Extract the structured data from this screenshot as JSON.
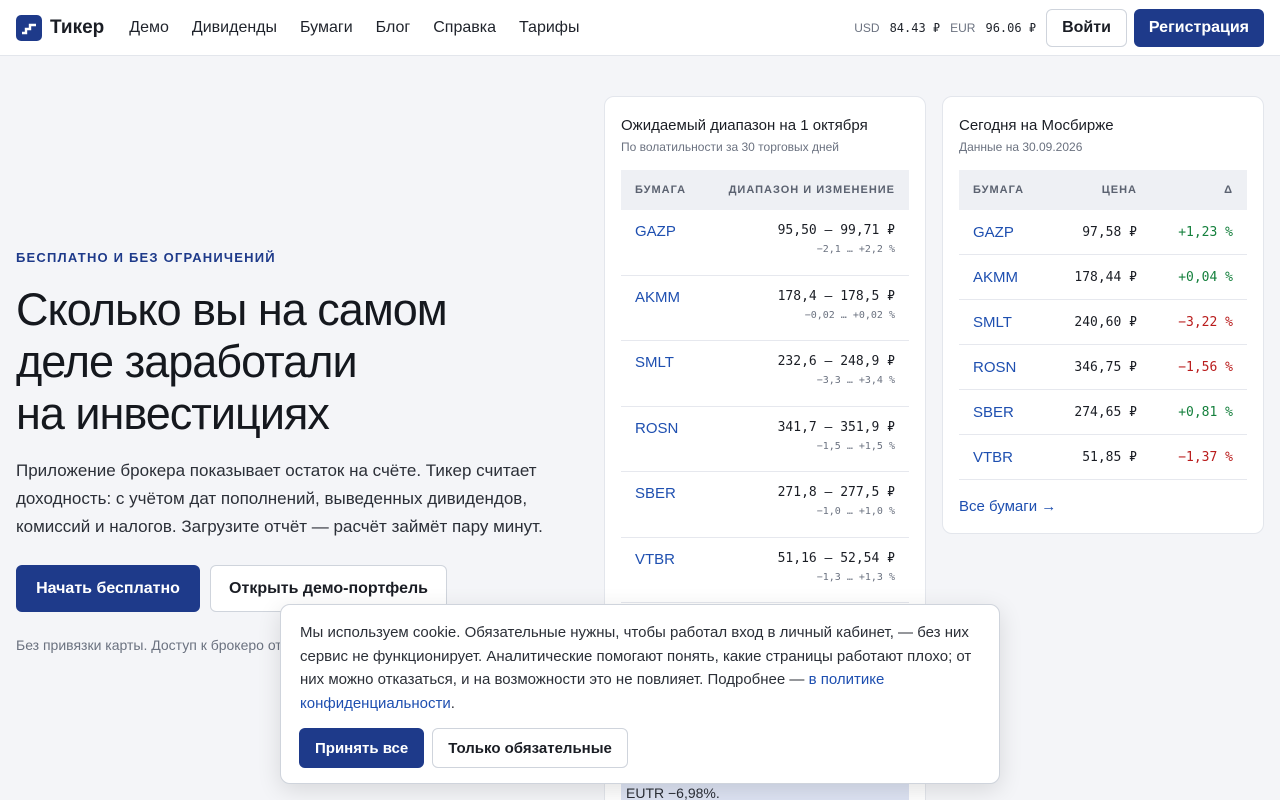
{
  "brand": {
    "name": "Тикер",
    "logo_icon": "stairs-chart-icon",
    "color": "#1e3a8a"
  },
  "nav": {
    "items": [
      {
        "label": "Демо"
      },
      {
        "label": "Дивиденды"
      },
      {
        "label": "Бумаги"
      },
      {
        "label": "Блог"
      },
      {
        "label": "Справка"
      },
      {
        "label": "Тарифы"
      }
    ]
  },
  "rates": {
    "usd_label": "USD",
    "usd_value": "84.43 ₽",
    "eur_label": "EUR",
    "eur_value": "96.06 ₽"
  },
  "auth": {
    "login": "Войти",
    "register": "Регистрация"
  },
  "hero": {
    "eyebrow": "БЕСПЛАТНО И БЕЗ ОГРАНИЧЕНИЙ",
    "headline_line1": "Сколько вы на самом",
    "headline_line2": "деле заработали",
    "headline_line3": "на инвестициях",
    "lead": "Приложение брокера показывает остаток на счёте. Тикер считает доходность: с учётом дат пополнений, выведенных дивидендов, комиссий и налогов. Загрузите отчёт — расчёт займёт пару минут.",
    "cta_primary": "Начать бесплатно",
    "cta_secondary": "Открыть демо-портфель",
    "footnote": "Без привязки карты. Доступ к брокеро отчёта."
  },
  "range_card": {
    "title": "Ожидаемый диапазон на 1 октября",
    "subtitle": "По волатильности за 30 торговых дней",
    "col_security": "БУМАГА",
    "col_range": "ДИАПАЗОН И ИЗМЕНЕНИЕ",
    "rows": [
      {
        "ticker": "GAZP",
        "range": "95,50 — 99,71 ₽",
        "change": "−2,1 … +2,2 %"
      },
      {
        "ticker": "AKMM",
        "range": "178,4 — 178,5 ₽",
        "change": "−0,02 … +0,02 %"
      },
      {
        "ticker": "SMLT",
        "range": "232,6 — 248,9 ₽",
        "change": "−3,3 … +3,4 %"
      },
      {
        "ticker": "ROSN",
        "range": "341,7 — 351,9 ₽",
        "change": "−1,5 … +1,5 %"
      },
      {
        "ticker": "SBER",
        "range": "271,8 — 277,5 ₽",
        "change": "−1,0 … +1,0 %"
      },
      {
        "ticker": "VTBR",
        "range": "51,16 — 52,54 ₽",
        "change": "−1,3 … +1,3 %"
      }
    ],
    "note": "EUTR −6,98%."
  },
  "moex_card": {
    "title": "Сегодня на Мосбирже",
    "subtitle": "Данные на 30.09.2026",
    "col_security": "БУМАГА",
    "col_price": "ЦЕНА",
    "col_delta": "Δ",
    "rows": [
      {
        "ticker": "GAZP",
        "price": "97,58 ₽",
        "delta": "+1,23 %",
        "dir": "up"
      },
      {
        "ticker": "AKMM",
        "price": "178,44 ₽",
        "delta": "+0,04 %",
        "dir": "up"
      },
      {
        "ticker": "SMLT",
        "price": "240,60 ₽",
        "delta": "−3,22 %",
        "dir": "down"
      },
      {
        "ticker": "ROSN",
        "price": "346,75 ₽",
        "delta": "−1,56 %",
        "dir": "down"
      },
      {
        "ticker": "SBER",
        "price": "274,65 ₽",
        "delta": "+0,81 %",
        "dir": "up"
      },
      {
        "ticker": "VTBR",
        "price": "51,85 ₽",
        "delta": "−1,37 %",
        "dir": "down"
      }
    ],
    "all_link": "Все бумаги →",
    "up_color": "#15803d",
    "down_color": "#b91c1c"
  },
  "cookie": {
    "text": "Мы используем cookie. Обязательные нужны, чтобы работал вход в личный кабинет, — без них сервис не функционирует. Аналитические помогают понять, какие страницы работают плохо; от них можно отказаться, и на возможности это не повлияет. Подробнее — ",
    "link": "в политике конфиденциальности",
    "after": ".",
    "accept": "Принять все",
    "required_only": "Только обязательные"
  }
}
